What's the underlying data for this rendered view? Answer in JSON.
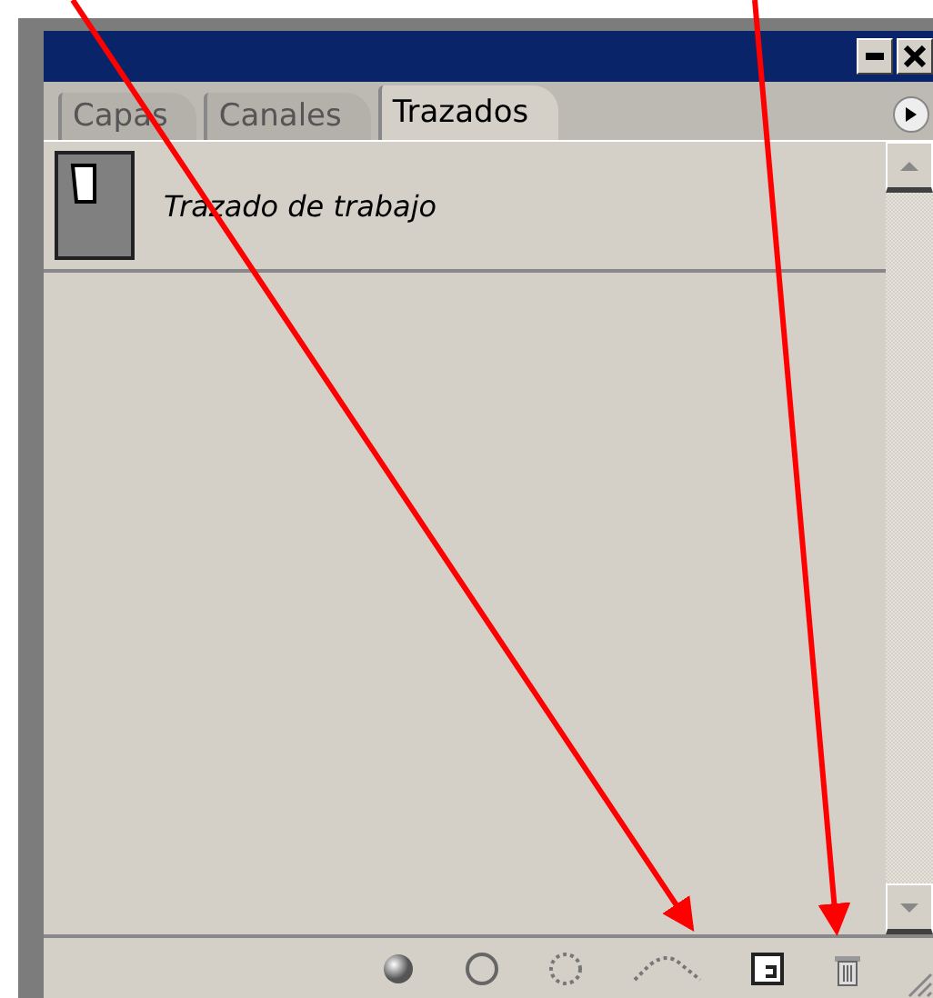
{
  "tabs": [
    {
      "label": "Capas",
      "selected": false
    },
    {
      "label": "Canales",
      "selected": false
    },
    {
      "label": "Trazados",
      "selected": true
    }
  ],
  "paths": [
    {
      "name": "Trazado de trabajo",
      "selected": false
    }
  ],
  "toolbar": [
    {
      "kind": "fill"
    },
    {
      "kind": "stroke"
    },
    {
      "kind": "selection"
    },
    {
      "kind": "workpath"
    },
    {
      "kind": "new"
    },
    {
      "kind": "delete"
    }
  ],
  "annotations": [
    {
      "kind": "arrow"
    },
    {
      "kind": "arrow"
    }
  ]
}
